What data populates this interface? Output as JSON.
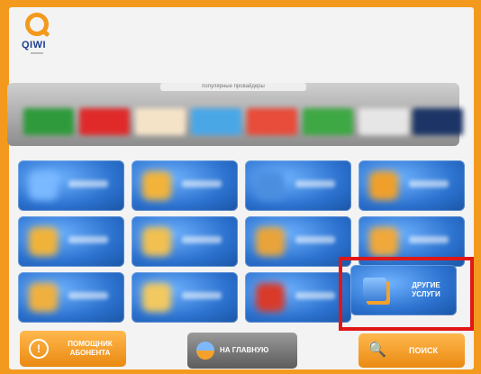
{
  "brand": {
    "logo_text": "QIWI"
  },
  "popular_section": {
    "title": "популярные провайдеры"
  },
  "other_services": {
    "label": "ДРУГИЕ УСЛУГИ"
  },
  "bottom_bar": {
    "help_label": "ПОМОЩНИК АБОНЕНТА",
    "help_icon": "!",
    "main_label": "НА ГЛАВНУЮ",
    "search_label": "ПОИСК",
    "search_icon": "🔍"
  },
  "colors": {
    "brand_orange": "#f39a1e",
    "tile_blue": "#2c72cf",
    "highlight_red": "#e11616"
  }
}
